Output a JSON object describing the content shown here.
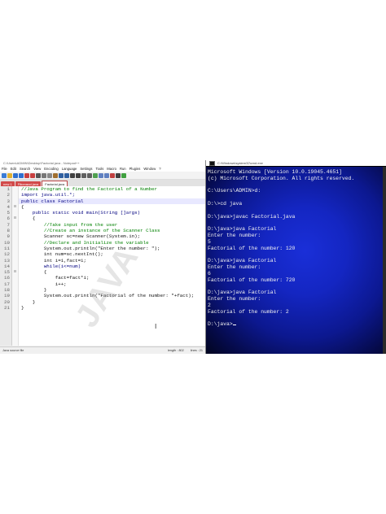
{
  "notepad": {
    "title": "C:\\Users\\ADMIN\\Desktop\\Factorial.java - Notepad++",
    "menu": [
      "File",
      "Edit",
      "Search",
      "View",
      "Encoding",
      "Language",
      "Settings",
      "Tools",
      "Macro",
      "Run",
      "Plugins",
      "Window",
      "?"
    ],
    "tabs": [
      "new 1",
      "Fibonacci.java",
      "Factorial.java"
    ],
    "active_tab": "Factorial.java",
    "line_numbers": [
      "1",
      "2",
      "3",
      "4",
      "5",
      "6",
      "7",
      "8",
      "9",
      "10",
      "11",
      "12",
      "13",
      "14",
      "15",
      "16",
      "17",
      "18",
      "19",
      "20",
      "21"
    ],
    "folds": [
      "",
      "",
      "",
      "⊟",
      "",
      "⊟",
      "",
      "",
      "",
      "",
      "",
      "",
      "",
      "",
      "⊟",
      "",
      "",
      "",
      "",
      "",
      ""
    ],
    "code": [
      "//Java Program to find the Factorial of a Number",
      "import java.util.*;",
      "public class Factorial",
      "{",
      "    public static void main(String []args)",
      "    {",
      "        //Take input from the user",
      "        //Create an instance of the Scanner Class",
      "        Scanner sc=new Scanner(System.in);",
      "        //Declare and Initialize the variable",
      "        System.out.println(\"Enter the number: \");",
      "        int num=sc.nextInt();",
      "        int i=1,fact=1;",
      "        while(i<=num)",
      "        {",
      "            fact=fact*i;",
      "            i++;",
      "        }",
      "        System.out.println(\"Factorial of the number: \"+fact);",
      "    }",
      "}"
    ],
    "status_left": "Java source file",
    "status_length": "length : 802",
    "status_lines": "lines : 21",
    "watermark": "JAVA"
  },
  "cmd": {
    "title": "C:\\Windows\\system32\\cmd.exe",
    "lines": [
      "Microsoft Windows [Version 10.0.19045.4651]",
      "(c) Microsoft Corporation. All rights reserved.",
      "",
      "C:\\Users\\ADMIN>d:",
      "",
      "D:\\>cd java",
      "",
      "D:\\java>javac Factorial.java",
      "",
      "D:\\java>java Factorial",
      "Enter the number:",
      "5",
      "Factorial of the number: 120",
      "",
      "D:\\java>java Factorial",
      "Enter the number:",
      "6",
      "Factorial of the number: 720",
      "",
      "D:\\java>java Factorial",
      "Enter the number:",
      "2",
      "Factorial of the number: 2",
      "",
      "D:\\java>"
    ]
  },
  "colors": {
    "cmd_background": "#1426c2",
    "comment": "#008000",
    "tab_inactive": "#d24a4a"
  }
}
